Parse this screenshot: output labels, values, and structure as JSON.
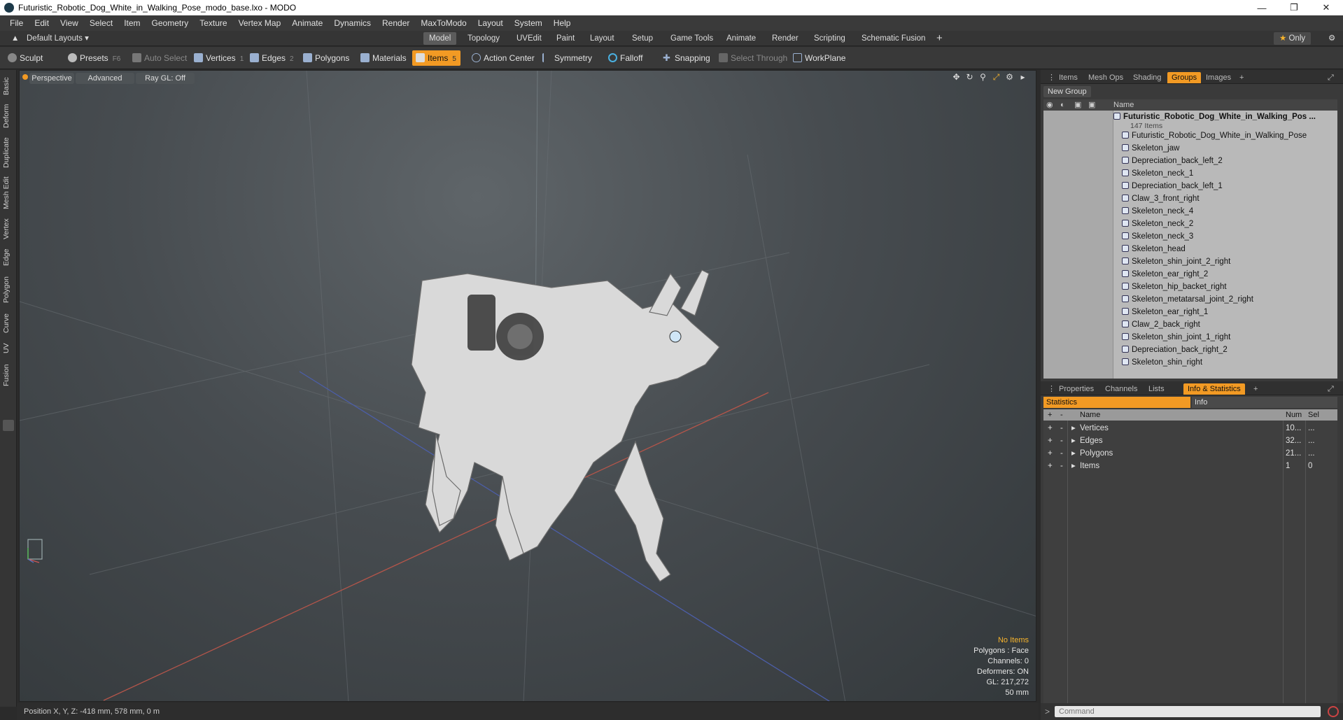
{
  "window": {
    "title": "Futuristic_Robotic_Dog_White_in_Walking_Pose_modo_base.lxo - MODO"
  },
  "menu": [
    "File",
    "Edit",
    "View",
    "Select",
    "Item",
    "Geometry",
    "Texture",
    "Vertex Map",
    "Animate",
    "Dynamics",
    "Render",
    "MaxToModo",
    "Layout",
    "System",
    "Help"
  ],
  "layout_bar": {
    "layouts_label": "Default Layouts",
    "tabs": [
      "Model",
      "Topology",
      "UVEdit",
      "Paint",
      "Layout",
      "Setup",
      "Game Tools",
      "Animate",
      "Render",
      "Scripting",
      "Schematic Fusion"
    ],
    "active_tab": "Model",
    "only_label": "Only"
  },
  "toolbar": {
    "sculpt": "Sculpt",
    "presets": "Presets",
    "presets_key": "F6",
    "auto_select": "Auto Select",
    "vertices": "Vertices",
    "vertices_count": "1",
    "edges": "Edges",
    "edges_count": "2",
    "polygons": "Polygons",
    "materials": "Materials",
    "items": "Items",
    "items_count": "5",
    "action_center": "Action Center",
    "symmetry": "Symmetry",
    "falloff": "Falloff",
    "snapping": "Snapping",
    "select_through": "Select Through",
    "workplane": "WorkPlane"
  },
  "left_tabs": [
    "Basic",
    "Deform",
    "Duplicate",
    "Mesh Edit",
    "Vertex",
    "Edge",
    "Polygon",
    "Curve",
    "UV",
    "Fusion"
  ],
  "viewport": {
    "perspective": "Perspective",
    "advanced": "Advanced",
    "raygl": "Ray GL: Off",
    "stats": {
      "no_items": "No Items",
      "polygons": "Polygons : Face",
      "channels": "Channels: 0",
      "deformers": "Deformers: ON",
      "gl": "GL: 217,272",
      "scale": "50 mm"
    }
  },
  "status": {
    "position": "Position X, Y, Z:  -418 mm, 578 mm, 0 m"
  },
  "groups_panel": {
    "tabs": [
      "Items",
      "Mesh Ops",
      "Shading",
      "Groups",
      "Images"
    ],
    "active_tab": "Groups",
    "new_group": "New Group",
    "name_header": "Name",
    "root": "Futuristic_Robotic_Dog_White_in_Walking_Pos ...",
    "root_count": "147 Items",
    "items": [
      "Futuristic_Robotic_Dog_White_in_Walking_Pose",
      "Skeleton_jaw",
      "Depreciation_back_left_2",
      "Skeleton_neck_1",
      "Depreciation_back_left_1",
      "Claw_3_front_right",
      "Skeleton_neck_4",
      "Skeleton_neck_2",
      "Skeleton_neck_3",
      "Skeleton_head",
      "Skeleton_shin_joint_2_right",
      "Skeleton_ear_right_2",
      "Skeleton_hip_backet_right",
      "Skeleton_metatarsal_joint_2_right",
      "Skeleton_ear_right_1",
      "Claw_2_back_right",
      "Skeleton_shin_joint_1_right",
      "Depreciation_back_right_2",
      "Skeleton_shin_right"
    ]
  },
  "stats_panel": {
    "tabs": [
      "Properties",
      "Channels",
      "Lists",
      "Info & Statistics"
    ],
    "active_tab": "Info & Statistics",
    "sub_tabs": [
      "Statistics",
      "Info"
    ],
    "columns": [
      "Name",
      "Num",
      "Sel"
    ],
    "rows": [
      {
        "name": "Vertices",
        "num": "10...",
        "sel": "..."
      },
      {
        "name": "Edges",
        "num": "32...",
        "sel": "..."
      },
      {
        "name": "Polygons",
        "num": "21...",
        "sel": "..."
      },
      {
        "name": "Items",
        "num": "1",
        "sel": "0"
      }
    ]
  },
  "command": {
    "placeholder": "Command"
  },
  "colors": {
    "accent": "#f29a24",
    "viewport": "#474c50"
  }
}
